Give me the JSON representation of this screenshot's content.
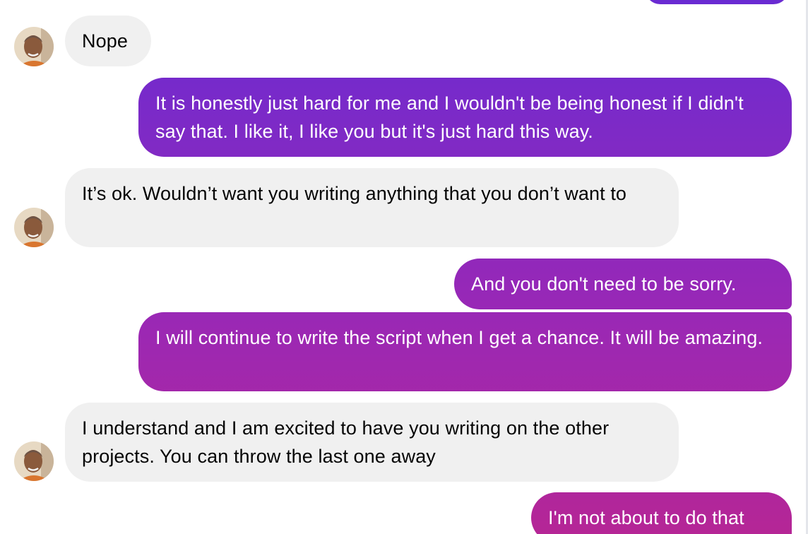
{
  "conversation": {
    "messages": [
      {
        "sender": "other",
        "text": "Nope"
      },
      {
        "sender": "me",
        "text": "It is honestly just hard for me and I wouldn't be being honest if I didn't say that. I like it, I like you but it's just hard this way."
      },
      {
        "sender": "other",
        "text": "It’s ok. Wouldn’t want you writing anything that you don’t want to"
      },
      {
        "sender": "me",
        "text": "And you don't need to be sorry."
      },
      {
        "sender": "me",
        "text": "I will continue to write the script when I get a chance. It will be amazing."
      },
      {
        "sender": "other",
        "text": "I understand and I am excited to have you writing on the other projects. You can throw the last one away"
      },
      {
        "sender": "me",
        "text": "I'm not about to do that"
      }
    ]
  },
  "colors": {
    "incoming_bubble": "#f0f0f0",
    "outgoing_gradient_top": "#6a2bd2",
    "outgoing_gradient_bottom": "#b52696"
  },
  "icons": {
    "contact_avatar": "contact-avatar-photo"
  }
}
